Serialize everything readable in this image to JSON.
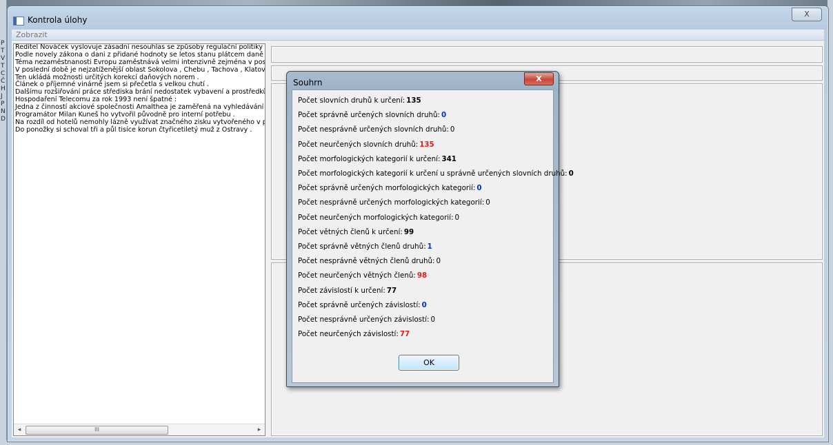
{
  "window": {
    "title": "Kontrola úlohy",
    "close_label": "X"
  },
  "menu": {
    "items": [
      "Zobrazit"
    ]
  },
  "sentences": [
    "Ředitel Nováček vyslovuje zásadní nesouhlas se způsoby regulační politiky",
    "Podle novely zákona o dani z přidané hodnoty se letos stanu plátcem daně",
    "Téma nezaměstnanosti Evropu zaměstnává velmi intenzivně zejména v pos",
    "V poslední době je nejzatíženější oblast Sokolova , Chebu , Tachova , Klatov",
    "Ten ukládá možnosti určitých korekcí daňových norem .",
    "Článek o příjemné vinárně jsem si přečetla s velkou chutí .",
    "Dalšímu rozšiřování práce střediska brání nedostatek vybavení a prostředků",
    "Hospodaření Telecomu za rok 1993 není špatné :",
    "Jedna z činností akciové společnosti Amalthea je zaměřená na vyhledávání",
    "Programátor Milan Kuneš ho vytvořil původně pro interní potřebu .",
    "Na rozdíl od hotelů nemohly lázně využívat značného zisku vytvořeného v p",
    "Do ponožky si schoval tři a půl tisíce korun čtyřicetiletý muž z Ostravy ."
  ],
  "left_gutter_letters": [
    "P",
    "T",
    "V",
    "T",
    "C",
    "Č",
    "H",
    "J",
    "P",
    "N",
    "D"
  ],
  "scrollbar": {
    "left_arrow": "◂",
    "right_arrow": "▸",
    "thumb_grip": "III"
  },
  "dialog": {
    "title": "Souhrn",
    "close_label": "X",
    "ok_label": "OK",
    "stats": [
      {
        "label": "Počet slovních druhů k určení:",
        "value": "135",
        "color": "#000000"
      },
      {
        "label": "Počet správně určených slovních druhů:",
        "value": "0",
        "color": "#0033cc"
      },
      {
        "label": "Počet nesprávně určených slovních druhů:",
        "value": "0",
        "color": "plain"
      },
      {
        "label": "Počet neurčených slovních druhů:",
        "value": "135",
        "color": "#e21c1c"
      },
      {
        "label": "Počet morfologických kategorií k určení:",
        "value": "341",
        "color": "#000000"
      },
      {
        "label": "Počet morfologických kategorií k určení u správně určených slovních druhů:",
        "value": "0",
        "color": "#000000"
      },
      {
        "label": "Počet správně určených morfologických kategorií:",
        "value": "0",
        "color": "#0033cc"
      },
      {
        "label": "Počet nesprávně určených morfologických kategorií:",
        "value": "0",
        "color": "plain"
      },
      {
        "label": "Počet neurčených morfologických kategorií:",
        "value": "0",
        "color": "plain"
      },
      {
        "label": "Počet větných členů k určení:",
        "value": "99",
        "color": "#000000"
      },
      {
        "label": "Počet správně větných členů druhů:",
        "value": "1",
        "color": "#0033cc"
      },
      {
        "label": "Počet nesprávně větných členů druhů:",
        "value": "0",
        "color": "plain"
      },
      {
        "label": "Počet neurčených větných členů:",
        "value": "98",
        "color": "#e21c1c"
      },
      {
        "label": "Počet závislostí k určení:",
        "value": "77",
        "color": "#000000"
      },
      {
        "label": "Počet správně určených závislostí:",
        "value": "0",
        "color": "#0033cc"
      },
      {
        "label": "Počet nesprávně určených závislostí:",
        "value": "0",
        "color": "plain"
      },
      {
        "label": "Počet neurčených závislostí:",
        "value": "77",
        "color": "#e21c1c"
      }
    ]
  }
}
